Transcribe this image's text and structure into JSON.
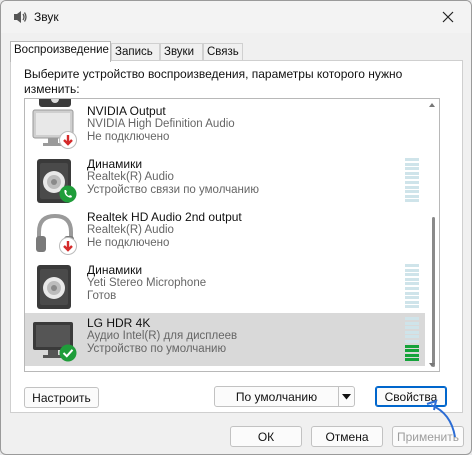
{
  "window": {
    "title": "Звук"
  },
  "tabs": [
    {
      "label": "Воспроизведение"
    },
    {
      "label": "Запись"
    },
    {
      "label": "Звуки"
    },
    {
      "label": "Связь"
    }
  ],
  "instruction": "Выберите устройство воспроизведения, параметры которого нужно изменить:",
  "devices": [
    {
      "name": "NVIDIA Output",
      "driver": "NVIDIA High Definition Audio",
      "status": "Не подключено",
      "icon": "monitor-icon",
      "badge": "disconnected-badge"
    },
    {
      "name": "Динамики",
      "driver": "Realtek(R) Audio",
      "status": "Устройство связи по умолчанию",
      "icon": "speaker-icon",
      "badge": "phone-badge",
      "meter_level": 0
    },
    {
      "name": "Realtek HD Audio 2nd output",
      "driver": "Realtek(R) Audio",
      "status": "Не подключено",
      "icon": "headphones-icon",
      "badge": "disconnected-badge"
    },
    {
      "name": "Динамики",
      "driver": "Yeti Stereo Microphone",
      "status": "Готов",
      "icon": "speaker-icon",
      "meter_level": 0
    },
    {
      "name": "LG HDR 4K",
      "driver": "Аудио Intel(R) для дисплеев",
      "status": "Устройство по умолчанию",
      "icon": "monitor-icon",
      "badge": "default-check-badge",
      "meter_level": 0.4,
      "selected": true
    }
  ],
  "buttons": {
    "configure": "Настроить",
    "set_default": "По умолчанию",
    "properties": "Свойства",
    "ok": "ОК",
    "cancel": "Отмена",
    "apply": "Применить"
  },
  "colors": {
    "meter_on": "#14a33a",
    "meter_off": "#cfe4ea",
    "disconnected": "#d42a2a",
    "default": "#1f9d3a",
    "accent": "#0066cc"
  }
}
